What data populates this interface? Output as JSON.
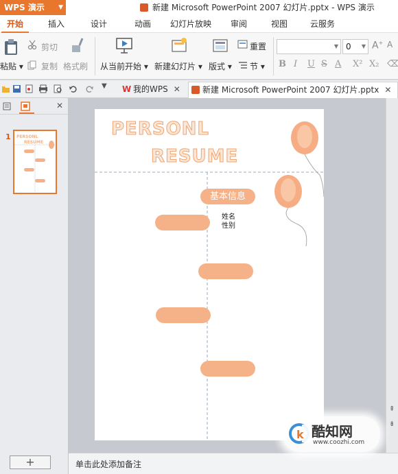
{
  "app": {
    "name": "WPS 演示",
    "document_title": "新建 Microsoft PowerPoint 2007 幻灯片.pptx - WPS 演示"
  },
  "menu": {
    "tabs": [
      "开始",
      "插入",
      "设计",
      "动画",
      "幻灯片放映",
      "审阅",
      "视图",
      "云服务"
    ],
    "active_index": 0
  },
  "ribbon": {
    "paste": "粘贴",
    "cut": "剪切",
    "copy": "复制",
    "format_painter": "格式刷",
    "from_current": "从当前开始",
    "new_slide": "新建幻灯片",
    "layout": "版式",
    "reset": "重置",
    "section": "节",
    "font_name": "",
    "font_size": "0",
    "format_buttons": [
      "B",
      "I",
      "U",
      "S",
      "A",
      "X²",
      "X₂"
    ]
  },
  "doc_tabs": [
    {
      "label": "我的WPS"
    },
    {
      "label": "新建 Microsoft PowerPoint 2007 幻灯片.pptx"
    }
  ],
  "slides_panel": {
    "slide_number": "1",
    "add_label": "+"
  },
  "slide": {
    "title_line1": "PERSONL",
    "title_line2": "RESUME",
    "section_label": "基本信息",
    "fields": [
      "姓名",
      "性别"
    ]
  },
  "notes_placeholder": "单击此处添加备注",
  "watermark": {
    "title": "酷知网",
    "url": "www.coozhi.com"
  },
  "colors": {
    "accent": "#e8762c",
    "pill": "#f5b288",
    "balloon": "#f6ad84",
    "title_stroke": "#f0a36e"
  }
}
